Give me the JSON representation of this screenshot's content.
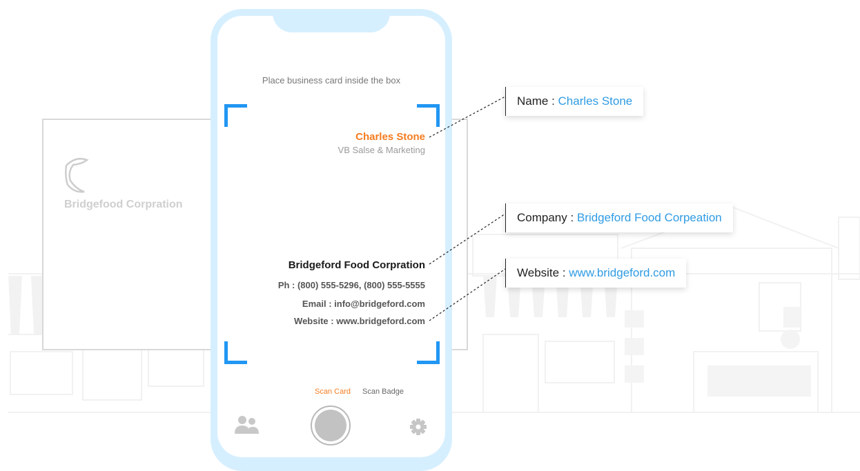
{
  "scanner": {
    "instruction": "Place business card inside the box",
    "modes": {
      "scan_card": "Scan Card",
      "scan_badge": "Scan Badge"
    },
    "active_mode": "Scan Card"
  },
  "paper_card": {
    "company": "Bridgefood Corpration"
  },
  "card": {
    "name": "Charles Stone",
    "title": "VB Salse & Marketing",
    "company": "Bridgeford Food Corpration",
    "phone": "Ph : (800) 555-5296, (800) 555-5555",
    "email": "Email : info@bridgeford.com",
    "website": "Website : www.bridgeford.com"
  },
  "callouts": {
    "name": {
      "label": "Name : ",
      "value": "Charles Stone"
    },
    "company": {
      "label": "Company : ",
      "value": "Bridgeford Food Corpeation"
    },
    "website": {
      "label": "Website : ",
      "value": "www.bridgeford.com"
    }
  },
  "icons": {
    "contacts": "people-icon",
    "settings": "gear-icon",
    "logo": "leaf-logo-icon"
  },
  "colors": {
    "accent_blue": "#2196f3",
    "accent_orange": "#f57c1f",
    "phone_frame": "#d6efff",
    "link_blue": "#2f9be3"
  }
}
